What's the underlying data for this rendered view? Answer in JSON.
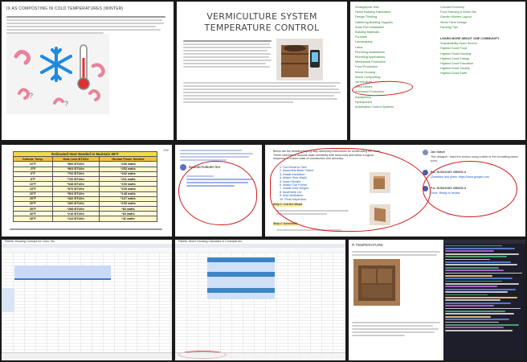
{
  "tile1": {
    "title": "IX AS COMPOSTING IN COLD TEMPERATURES (WINTER)"
  },
  "tile2": {
    "heading": "VERMICULTURE SYSTEM TEMPERATURE CONTROL"
  },
  "tile3": {
    "links_left": [
      "Stratigraphic Wiki",
      "Home Building Fabrication",
      "Design Thinking",
      "Gathering Building Supplies",
      "Solar Pad Installation",
      "Building Materials",
      "Furniture",
      "Landscaping",
      "Labor",
      "Plumbing Installations",
      "Plumbing Applications",
      "Mechanical Production",
      "Food Production",
      "Worm Growing",
      "Worm Composting",
      "Vermiculture",
      "Seed Library",
      "Advanced Production",
      "Aquaponics",
      "Hydroponics",
      "Automation Control Systems"
    ],
    "links_right": [
      "Circular Economy",
      "Food Farming & Worm Bin",
      "Garden Kitchen Layout",
      "Worm Farm Design",
      "Farming Tips"
    ],
    "section_right": "LEARN MORE ABOUT ONE COMMUNITY",
    "links_right_more": [
      "Sustainability Open Source",
      "Highest Good Food",
      "Highest Good Housing",
      "Highest Good Energy",
      "Highest Good Education",
      "Highest Good Society",
      "Highest Good Earth"
    ]
  },
  "tile4": {
    "table_title": "Estimated Heat Needed to Maintain 55°F",
    "columns": [
      "Outside Temp.",
      "Heat Loss BTU/hr",
      "Human Power Needed"
    ],
    "rows": [
      [
        "10°F",
        "*806 BTU/hr",
        "*236 watts"
      ],
      [
        "-5°F",
        "*864 BTU/hr",
        "*253 watts"
      ],
      [
        "0°F",
        "*792 BTU/hr",
        "*232 watts"
      ],
      [
        "5°F",
        "*720 BTU/hr",
        "*211 watts"
      ],
      [
        "10°F",
        "*648 BTU/hr",
        "*190 watts"
      ],
      [
        "15°F",
        "*576 BTU/hr",
        "*169 watts"
      ],
      [
        "20°F",
        "*504 BTU/hr",
        "*148 watts"
      ],
      [
        "25°F",
        "*432 BTU/hr",
        "*127 watts"
      ],
      [
        "30°F",
        "*360 BTU/hr",
        "*105 watts"
      ],
      [
        "35°F",
        "*288 BTU/hr",
        "*84 watts"
      ],
      [
        "40°F",
        "*216 BTU/hr",
        "*63 watts"
      ],
      [
        "45°F",
        "*144 BTU/hr",
        "*42 watts"
      ]
    ],
    "side_label": "292"
  },
  "tile5": {
    "user_name": "RAJESH PURKER-TEO"
  },
  "tile6": {
    "intro": "Below are the detailed step-by-step assembly instructions for constructing the vermi. These instructions assume basic familiarity with hand tools and follow a logical sequence to ensure ease of construction and accuracy.",
    "steps": [
      "1. Cut Wood to Size",
      "2. Assemble Base Frame",
      "3. Install Insulation",
      "4. Attach Side Walls",
      "5. Insert Divider",
      "6. Attach Top Frame",
      "7. Install Door Hinges",
      "8. Assemble Lid",
      "9. Add Ventilation",
      "10. Final Inspection"
    ],
    "step1_title": "Step 1: Cut the Wood",
    "step2_title": "Step 2: Assemble",
    "comments": [
      {
        "name": "Jan Gatsel",
        "text": "This designer: Mark the section using a table or the formatting below point."
      },
      {
        "name": "P.A. HUHAGUIS OBWOLU",
        "text": "Questions and plans: https://docs.google.com"
      },
      {
        "name": "P.A. HUHAGUIS OBWOLU",
        "text": "Done. Ready to review."
      }
    ]
  },
  "tile7": {
    "tab_title": "Pallets: Housing Concept for Cons. etc."
  },
  "tile8": {
    "tab_title": "Pallets: Worm Housing Calculator & Concepts etc."
  },
  "tile9": {
    "title": "R TEMPERATURE"
  },
  "colors": {
    "accent_red": "#d21b1b",
    "table_yellow": "#f6d94a",
    "link_green": "#2a7b2a"
  }
}
